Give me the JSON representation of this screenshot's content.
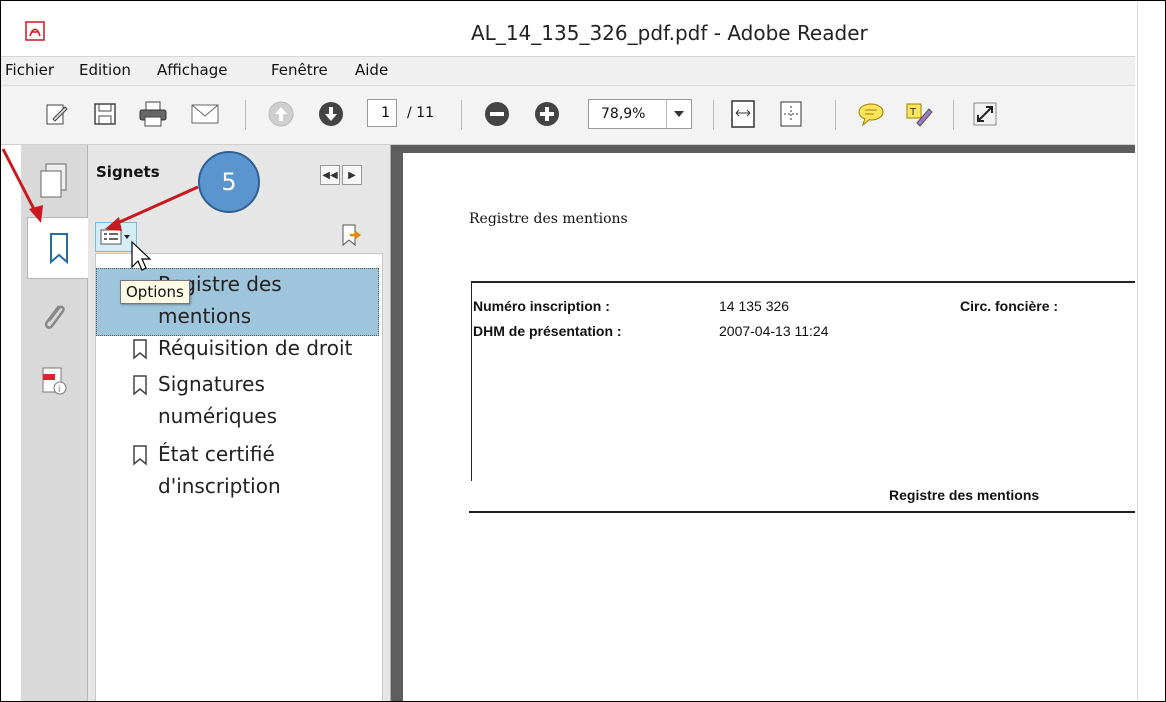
{
  "window": {
    "title": "AL_14_135_326_pdf.pdf - Adobe Reader"
  },
  "menu": {
    "items": [
      "Fichier",
      "Edition",
      "Affichage",
      "Fenêtre",
      "Aide"
    ]
  },
  "toolbar": {
    "page_current": "1",
    "page_total": "/ 11",
    "zoom": "78,9%",
    "icons": [
      "edit-icon",
      "save-icon",
      "print-icon",
      "email-icon",
      "prev-page-icon",
      "next-page-icon",
      "zoom-out-icon",
      "zoom-in-icon",
      "fit-page-icon",
      "fit-width-icon",
      "comment-icon",
      "highlight-icon",
      "fullscreen-icon"
    ]
  },
  "bookmarks": {
    "panel_title": "Signets",
    "tooltip": "Options",
    "items": [
      {
        "line1": "Registre des",
        "line2": "mentions",
        "selected": true
      },
      {
        "line1": "Réquisition de droit",
        "line2": ""
      },
      {
        "line1": "Signatures",
        "line2": "numériques"
      },
      {
        "line1": "État certifié",
        "line2": "d'inscription"
      }
    ]
  },
  "document": {
    "heading": "Registre des mentions",
    "fields": {
      "numero_label": "Numéro inscription :",
      "numero_value": "14 135 326",
      "circ_label": "Circ. foncière :",
      "dhm_label": "DHM de présentation :",
      "dhm_value": "2007-04-13 11:24"
    },
    "footer": "Registre des mentions"
  },
  "annotation": {
    "step": "5",
    "color": "#5b95cf",
    "arrow_color": "#c8191e"
  }
}
